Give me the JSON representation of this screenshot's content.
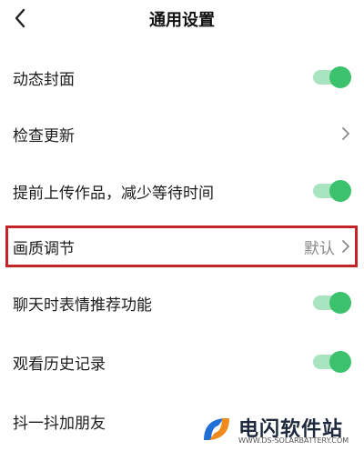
{
  "header": {
    "title": "通用设置",
    "back_icon": "chevron-left-icon"
  },
  "settings": [
    {
      "label": "动态封面",
      "control": "toggle",
      "on": true
    },
    {
      "label": "检查更新",
      "control": "chevron"
    },
    {
      "label": "提前上传作品，减少等待时间",
      "control": "toggle",
      "on": true
    },
    {
      "label": "画质调节",
      "control": "chevron",
      "value": "默认"
    },
    {
      "label": "聊天时表情推荐功能",
      "control": "toggle",
      "on": true
    },
    {
      "label": "观看历史记录",
      "control": "toggle",
      "on": true
    },
    {
      "label": "抖一抖加朋友",
      "control": "none"
    }
  ],
  "watermark": {
    "title": "电闪软件站",
    "subtitle": "WWW.DS-SOLARBATTERY.COM"
  },
  "colors": {
    "toggle_on": "#3cc16d",
    "toggle_track": "#a9e4c0",
    "highlight": "#c42427"
  }
}
